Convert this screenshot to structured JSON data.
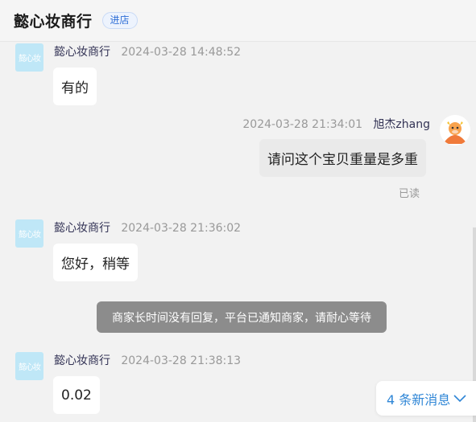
{
  "header": {
    "title": "懿心妆商行",
    "enter_label": "进店"
  },
  "shop_avatar_text": "懿心妆",
  "messages": [
    {
      "sender": "懿心妆商行",
      "time": "2024-03-28 14:48:52",
      "text": "有的"
    },
    {
      "sender": "旭杰zhang",
      "time": "2024-03-28 21:34:01",
      "text": "请问这个宝贝重量是多重",
      "status": "已读"
    },
    {
      "sender": "懿心妆商行",
      "time": "2024-03-28 21:36:02",
      "text": "您好，稍等"
    },
    {
      "sender": "懿心妆商行",
      "time": "2024-03-28 21:38:13",
      "text": "0.02"
    }
  ],
  "system_tip": "商家长时间没有回复，平台已通知商家，请耐心等待",
  "new_messages": {
    "label": "4 条新消息",
    "icon": "chevron-down-icon"
  },
  "colors": {
    "accent": "#2f86d6",
    "tip_bg": "#8c8c8c",
    "avatar_shop_bg": "#bfe7f7",
    "user_avatar": "#f07a3a"
  }
}
